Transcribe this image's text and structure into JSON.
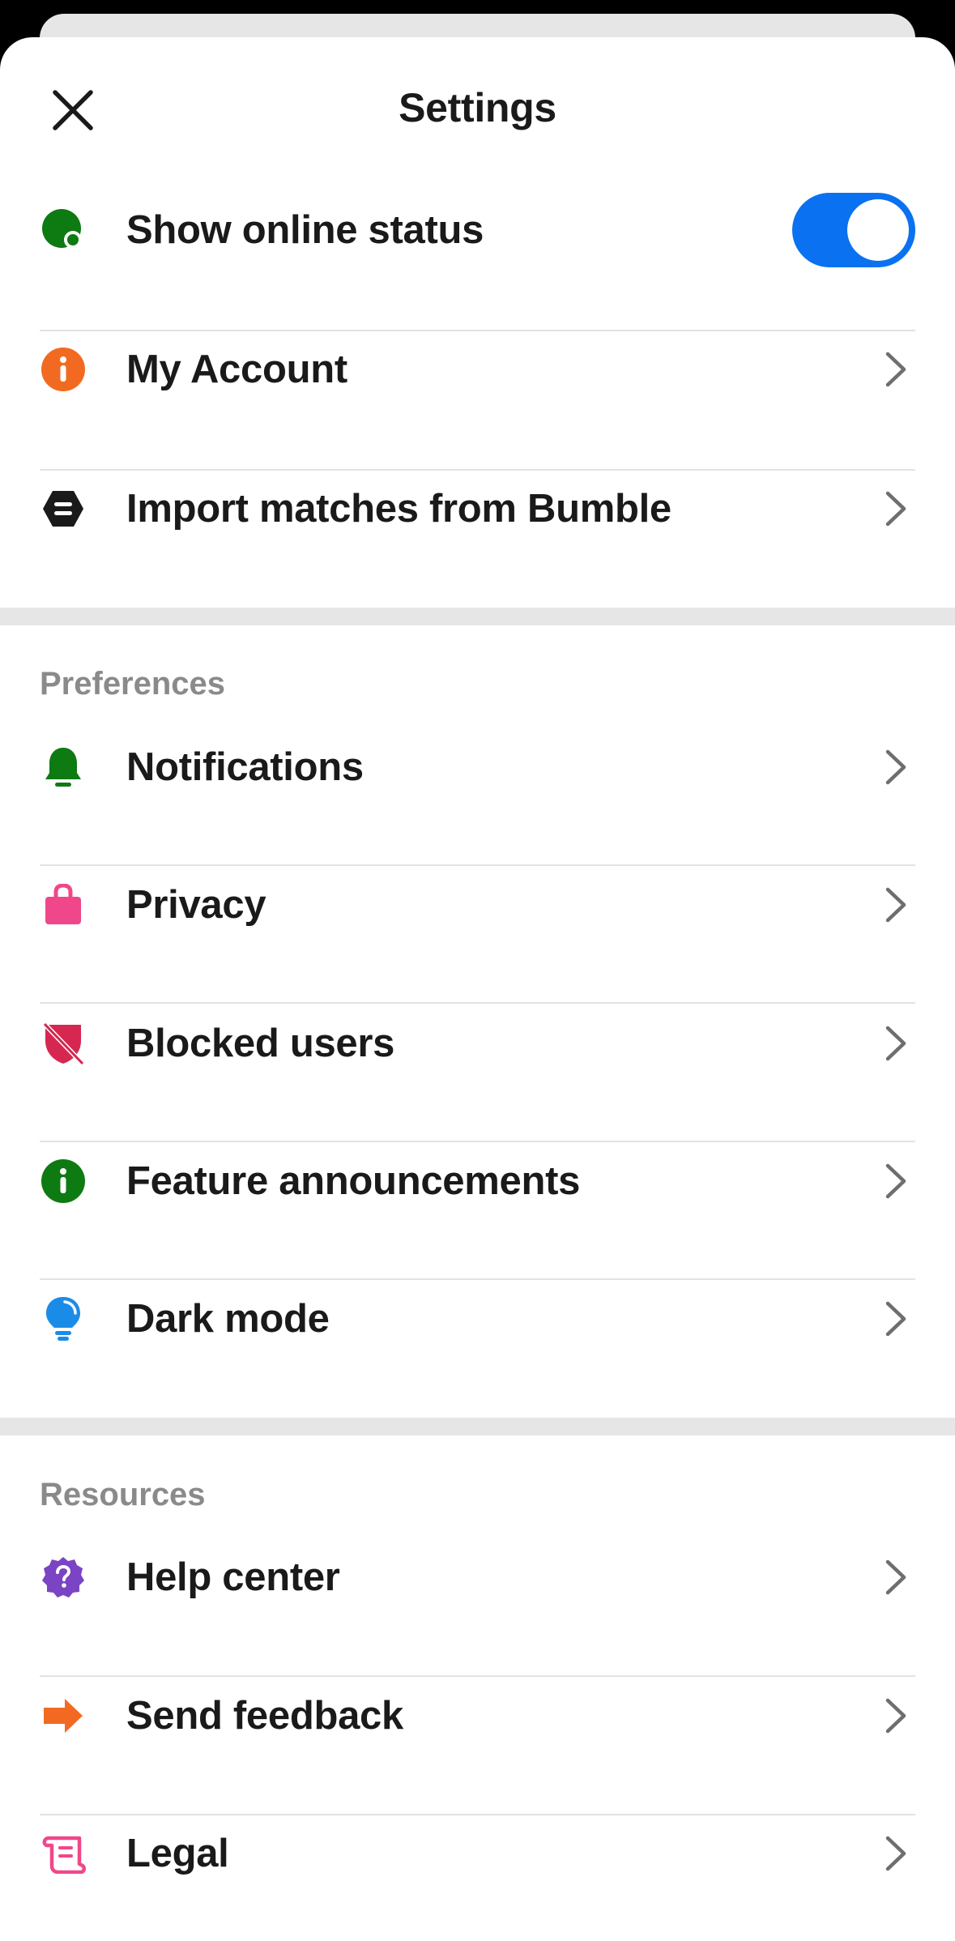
{
  "header": {
    "title": "Settings"
  },
  "account_items": [
    {
      "label": "Show online status",
      "toggle_on": true
    },
    {
      "label": "My Account"
    },
    {
      "label": "Import matches from Bumble"
    }
  ],
  "preferences": {
    "title": "Preferences",
    "items": [
      {
        "label": "Notifications"
      },
      {
        "label": "Privacy"
      },
      {
        "label": "Blocked users"
      },
      {
        "label": "Feature announcements"
      },
      {
        "label": "Dark mode"
      }
    ]
  },
  "resources": {
    "title": "Resources",
    "items": [
      {
        "label": "Help center"
      },
      {
        "label": "Send feedback"
      },
      {
        "label": "Legal"
      }
    ]
  },
  "colors": {
    "toggle_on": "#0a72f0",
    "green": "#0e7a12",
    "orange": "#f26a22",
    "pink": "#f0478a",
    "red": "#d62750",
    "blue": "#1a8ce8",
    "purple": "#7a44c4"
  }
}
